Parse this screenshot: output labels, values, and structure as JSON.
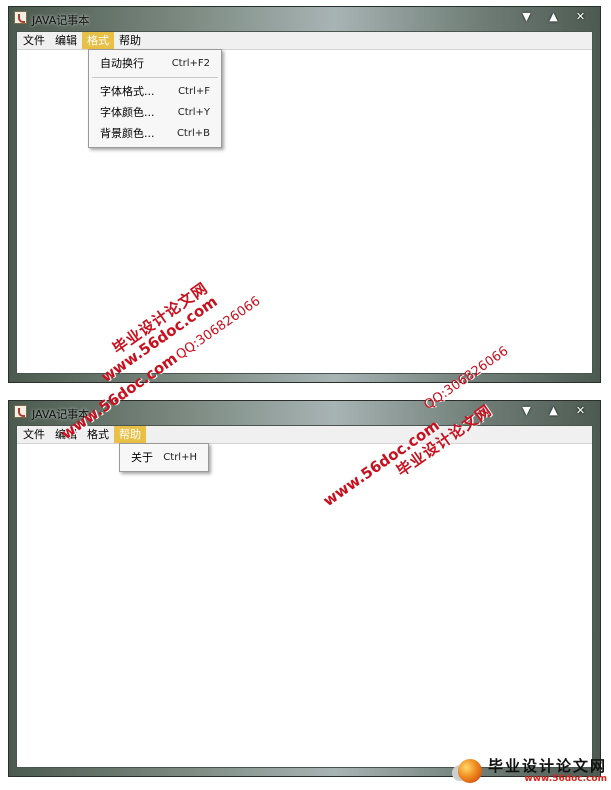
{
  "window_title": "JAVA记事本",
  "window_buttons": {
    "minimize": "▼",
    "maximize": "▲",
    "close": "✕"
  },
  "menubar": [
    "文件",
    "编辑",
    "格式",
    "帮助"
  ],
  "screen1": {
    "active_menu": "格式",
    "dropdown": [
      {
        "label": "自动换行",
        "accel": "Ctrl+F2"
      },
      {
        "label": "字体格式...",
        "accel": "Ctrl+F"
      },
      {
        "label": "字体颜色...",
        "accel": "Ctrl+Y"
      },
      {
        "label": "背景颜色...",
        "accel": "Ctrl+B"
      }
    ]
  },
  "screen2": {
    "active_menu": "帮助",
    "dropdown": [
      {
        "label": "关于",
        "accel": "Ctrl+H"
      }
    ]
  },
  "watermark": {
    "site": "www.56doc.com",
    "brand": "毕业设计论文网",
    "qq": "QQ:306826066",
    "logo_site": "www.56doc.com"
  },
  "colors": {
    "active_menu_bg": "#e8c048",
    "watermark": "#c8101e"
  }
}
